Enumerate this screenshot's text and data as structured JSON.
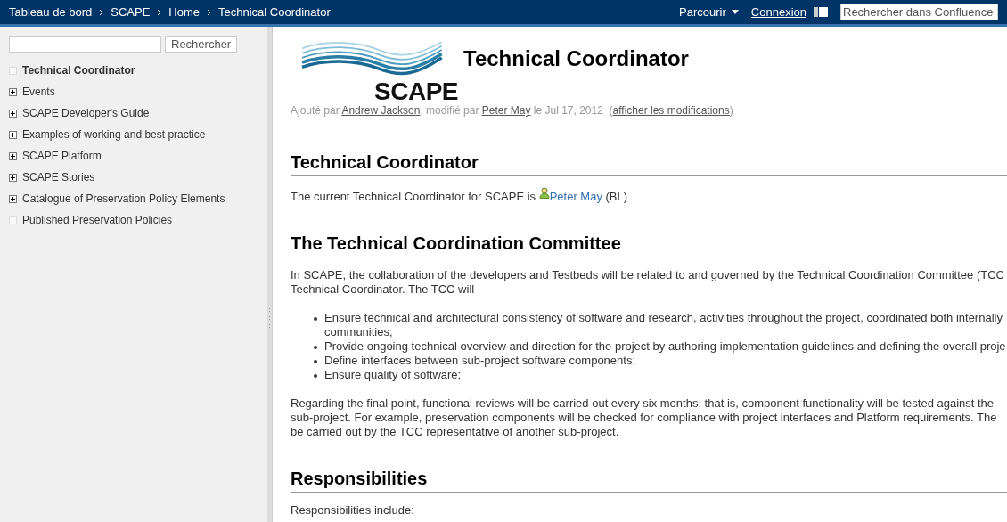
{
  "topbar": {
    "breadcrumbs": [
      "Tableau de bord",
      "SCAPE",
      "Home",
      "Technical Coordinator"
    ],
    "browse": "Parcourir",
    "login": "Connexion",
    "search": {
      "placeholder": "Rechercher dans Confluence"
    }
  },
  "sidebar": {
    "search_button": "Rechercher",
    "items": [
      {
        "label": "Technical Coordinator",
        "selected": true,
        "expandable": false
      },
      {
        "label": "Events",
        "selected": false,
        "expandable": true
      },
      {
        "label": "SCAPE Developer's Guide",
        "selected": false,
        "expandable": true
      },
      {
        "label": "Examples of working and best practice",
        "selected": false,
        "expandable": true
      },
      {
        "label": "SCAPE Platform",
        "selected": false,
        "expandable": true
      },
      {
        "label": "SCAPE Stories",
        "selected": false,
        "expandable": true
      },
      {
        "label": "Catalogue of Preservation Policy Elements",
        "selected": false,
        "expandable": true
      },
      {
        "label": "Published Preservation Policies",
        "selected": false,
        "expandable": false
      }
    ]
  },
  "page": {
    "logo_text": "SCAPE",
    "title": "Technical Coordinator",
    "meta": [
      {
        "kind": "text",
        "text": "Ajouté par "
      },
      {
        "kind": "link",
        "text": "Andrew Jackson"
      },
      {
        "kind": "text",
        "text": ", modifié par "
      },
      {
        "kind": "link",
        "text": "Peter May"
      },
      {
        "kind": "text",
        "text": " le Jul 17, 2012  ("
      },
      {
        "kind": "link",
        "text": "afficher les modifications"
      },
      {
        "kind": "text",
        "text": ")"
      }
    ],
    "sections": [
      {
        "heading": "Technical Coordinator",
        "blocks": [
          {
            "kind": "user_line",
            "before": "The current Technical Coordinator for SCAPE is ",
            "user": "Peter May",
            "after": " (BL)"
          }
        ]
      },
      {
        "heading": "The Technical Coordination Committee",
        "blocks": [
          {
            "kind": "paragraph",
            "lines": [
              "In SCAPE, the collaboration of the developers and Testbeds will be related to and governed by the Technical Coordination Committee (TCC",
              "Technical Coordinator. The TCC will"
            ]
          },
          {
            "kind": "bullets",
            "items": [
              {
                "lines": [
                  "Ensure technical and architectural consistency of software and research, activities throughout the project, coordinated both internally",
                  "communities;"
                ]
              },
              {
                "lines": [
                  "Provide ongoing technical overview and direction for the project by authoring implementation guidelines and defining the overall proje"
                ]
              },
              {
                "lines": [
                  "Define interfaces between sub-project software components;"
                ]
              },
              {
                "lines": [
                  "Ensure quality of software;"
                ]
              }
            ]
          },
          {
            "kind": "paragraph",
            "lines": [
              "Regarding the final point, functional reviews will be carried out every six months; that is, component functionality will be tested against the",
              "sub-project. For example, preservation components will be checked for compliance with project interfaces and Platform requirements. The",
              "be carried out by the TCC representative of another sub-project."
            ]
          }
        ]
      },
      {
        "heading": "Responsibilities",
        "blocks": [
          {
            "kind": "paragraph",
            "lines": [
              "Responsibilities include:"
            ]
          }
        ]
      }
    ]
  }
}
